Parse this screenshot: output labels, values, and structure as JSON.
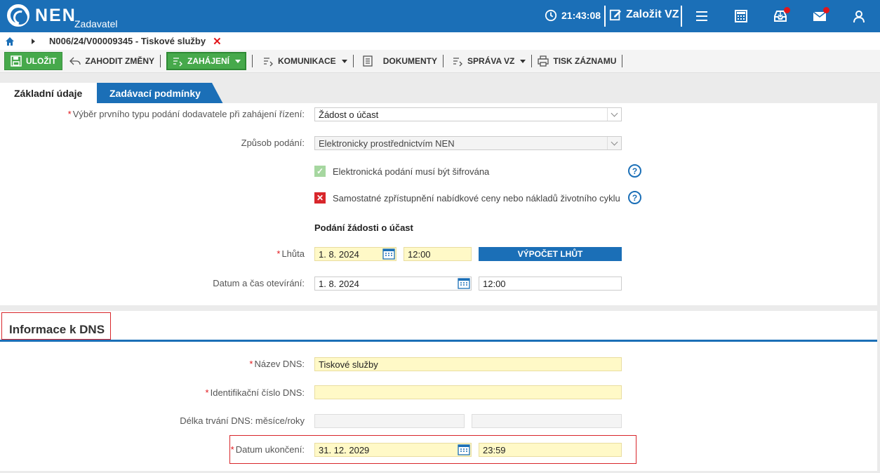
{
  "header": {
    "logo": "NEN",
    "role": "Zadavatel",
    "time": "21:43:08",
    "create_label": "Založit VZ"
  },
  "breadcrumb": {
    "title": "N006/24/V00009345 - Tiskové služby"
  },
  "toolbar": {
    "save": "ULOŽIT",
    "discard": "ZAHODIT ZMĚNY",
    "start": "ZAHÁJENÍ",
    "communication": "KOMUNIKACE",
    "documents": "DOKUMENTY",
    "management": "SPRÁVA VZ",
    "print": "TISK ZÁZNAMU"
  },
  "tabs": {
    "basic": "Základní údaje",
    "conditions": "Zadávací podmínky"
  },
  "form": {
    "first_type_label": "Výběr prvního typu podání dodavatele při zahájení řízení:",
    "first_type_value": "Žádost o účast",
    "method_label": "Způsob podání:",
    "method_value": "Elektronicky prostřednictvím NEN",
    "encrypted_label": "Elektronická podání musí být šifrována",
    "separate_label": "Samostatné zpřístupnění nabídkové ceny nebo nákladů životního cyklu",
    "submission_heading": "Podání žádosti o účast",
    "deadline_label": "Lhůta",
    "deadline_date": "1. 8. 2024",
    "deadline_time": "12:00",
    "calc_button": "VÝPOČET LHŮT",
    "opening_label": "Datum a čas otevírání:",
    "opening_date": "1. 8. 2024",
    "opening_time": "12:00"
  },
  "dns": {
    "section_title": "Informace k DNS",
    "name_label": "Název DNS:",
    "name_value": "Tiskové služby",
    "id_label": "Identifikační číslo DNS:",
    "id_value": "",
    "duration_label": "Délka trvání DNS: měsíce/roky",
    "end_label": "Datum ukončení:",
    "end_date": "31. 12. 2029",
    "end_time": "23:59"
  },
  "colors": {
    "brand_blue": "#1b6fb7",
    "green": "#46a94b",
    "required_red": "#e2161b",
    "yellow_field": "#fff9c7"
  }
}
